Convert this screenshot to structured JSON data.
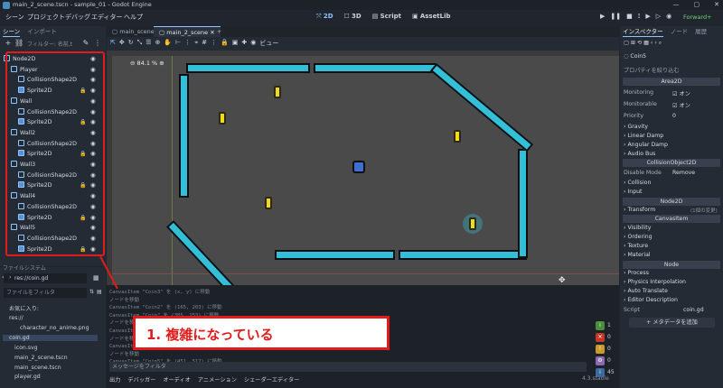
{
  "window": {
    "title": "main_2_scene.tscn - sample_01 - Godot Engine"
  },
  "menu": [
    "シーン",
    "プロジェクト",
    "デバッグ",
    "エディター",
    "ヘルプ"
  ],
  "main_tabs": [
    "2D",
    "3D",
    "Script",
    "AssetLib"
  ],
  "renderer": "Forward+",
  "scene_dock": {
    "tabs": [
      "シーン",
      "インポート"
    ],
    "filter_label": "フィルター: 名前,t",
    "tree": [
      {
        "name": "Node2D",
        "icon": "node2d-icon"
      },
      {
        "name": "Player",
        "icon": "player-icon"
      },
      {
        "name": "CollisionShape2D",
        "icon": "collision-shape-icon"
      },
      {
        "name": "Sprite2D",
        "icon": "sprite-icon"
      },
      {
        "name": "Wall",
        "icon": "area2d-icon"
      },
      {
        "name": "CollisionShape2D",
        "icon": "collision-shape-icon"
      },
      {
        "name": "Sprite2D",
        "icon": "sprite-icon"
      },
      {
        "name": "Wall2",
        "icon": "area2d-icon"
      },
      {
        "name": "CollisionShape2D",
        "icon": "collision-shape-icon"
      },
      {
        "name": "Sprite2D",
        "icon": "sprite-icon"
      },
      {
        "name": "Wall3",
        "icon": "area2d-icon"
      },
      {
        "name": "CollisionShape2D",
        "icon": "collision-shape-icon"
      },
      {
        "name": "Sprite2D",
        "icon": "sprite-icon"
      },
      {
        "name": "Wall4",
        "icon": "area2d-icon"
      },
      {
        "name": "CollisionShape2D",
        "icon": "collision-shape-icon"
      },
      {
        "name": "Sprite2D",
        "icon": "sprite-icon"
      },
      {
        "name": "Wall5",
        "icon": "area2d-icon"
      },
      {
        "name": "CollisionShape2D",
        "icon": "collision-shape-icon"
      },
      {
        "name": "Sprite2D",
        "icon": "sprite-icon"
      }
    ]
  },
  "filesystem": {
    "tab": "ファイルシステム",
    "path": "res://coin.gd",
    "filter_placeholder": "ファイルをフィルタ",
    "items": [
      {
        "label": "お気に入り:",
        "selected": false
      },
      {
        "label": "res://",
        "selected": false
      },
      {
        "label": "character_no_anime.png",
        "selected": false
      },
      {
        "label": "coin.gd",
        "selected": true
      },
      {
        "label": "icon.svg",
        "selected": false
      },
      {
        "label": "main_2_scene.tscn",
        "selected": false
      },
      {
        "label": "main_scene.tscn",
        "selected": false
      },
      {
        "label": "player.gd",
        "selected": false
      }
    ]
  },
  "editor": {
    "tabs": [
      "main_scene",
      "main_2_scene"
    ],
    "view_label": "ビュー",
    "zoom": "84.1 %"
  },
  "output": {
    "log": [
      "CanvasItem \"Coin3\" を (x, y) に移動",
      "ノードを移動",
      "CanvasItem \"Coin2\" を (165, 203) に移動",
      "CanvasItem \"Coin\" を (385, 153) に移動",
      "ノードを移動",
      "CanvasItem",
      "ノードを移動",
      "CanvasItem",
      "ノードを移動",
      "CanvasItem \"Coin5\" を (451, 517) に移動"
    ],
    "filter_placeholder": "メッセージをフィルタ",
    "bottom_tabs": [
      "出力",
      "デバッガー",
      "オーディオ",
      "アニメーション",
      "シェーダーエディター"
    ],
    "version": "4.3.stable",
    "counts": [
      "1",
      "0",
      "0",
      "0",
      "45"
    ]
  },
  "inspector": {
    "tabs": [
      "インスペクター",
      "ノード",
      "履歴"
    ],
    "object": "Coin5",
    "filter_placeholder": "プロパティを絞り込む",
    "class_header": "Area2D",
    "props": [
      {
        "name": "Monitoring",
        "value": "オン"
      },
      {
        "name": "Monitorable",
        "value": "オン"
      },
      {
        "name": "Priority",
        "value": "0"
      }
    ],
    "groups_area": [
      "Gravity",
      "Linear Damp",
      "Angular Damp",
      "Audio Bus"
    ],
    "header2": "CollisionObject2D",
    "disable_mode": {
      "name": "Disable Mode",
      "value": "Remove"
    },
    "groups_co": [
      "Collision",
      "Input"
    ],
    "header3": "Node2D",
    "transform": {
      "name": "Transform",
      "hint": "(1個の変更)"
    },
    "header4": "CanvasItem",
    "groups_ci": [
      "Visibility",
      "Ordering",
      "Texture",
      "Material"
    ],
    "header5": "Node",
    "groups_node": [
      "Process",
      "Physics Interpolation",
      "Auto Translate",
      "Editor Description"
    ],
    "script": {
      "name": "Script",
      "value": "coin.gd"
    },
    "add_meta": "メタデータを追加"
  },
  "annotation": {
    "text": "1. 複雑になっている",
    "color": "#e21b1b"
  }
}
